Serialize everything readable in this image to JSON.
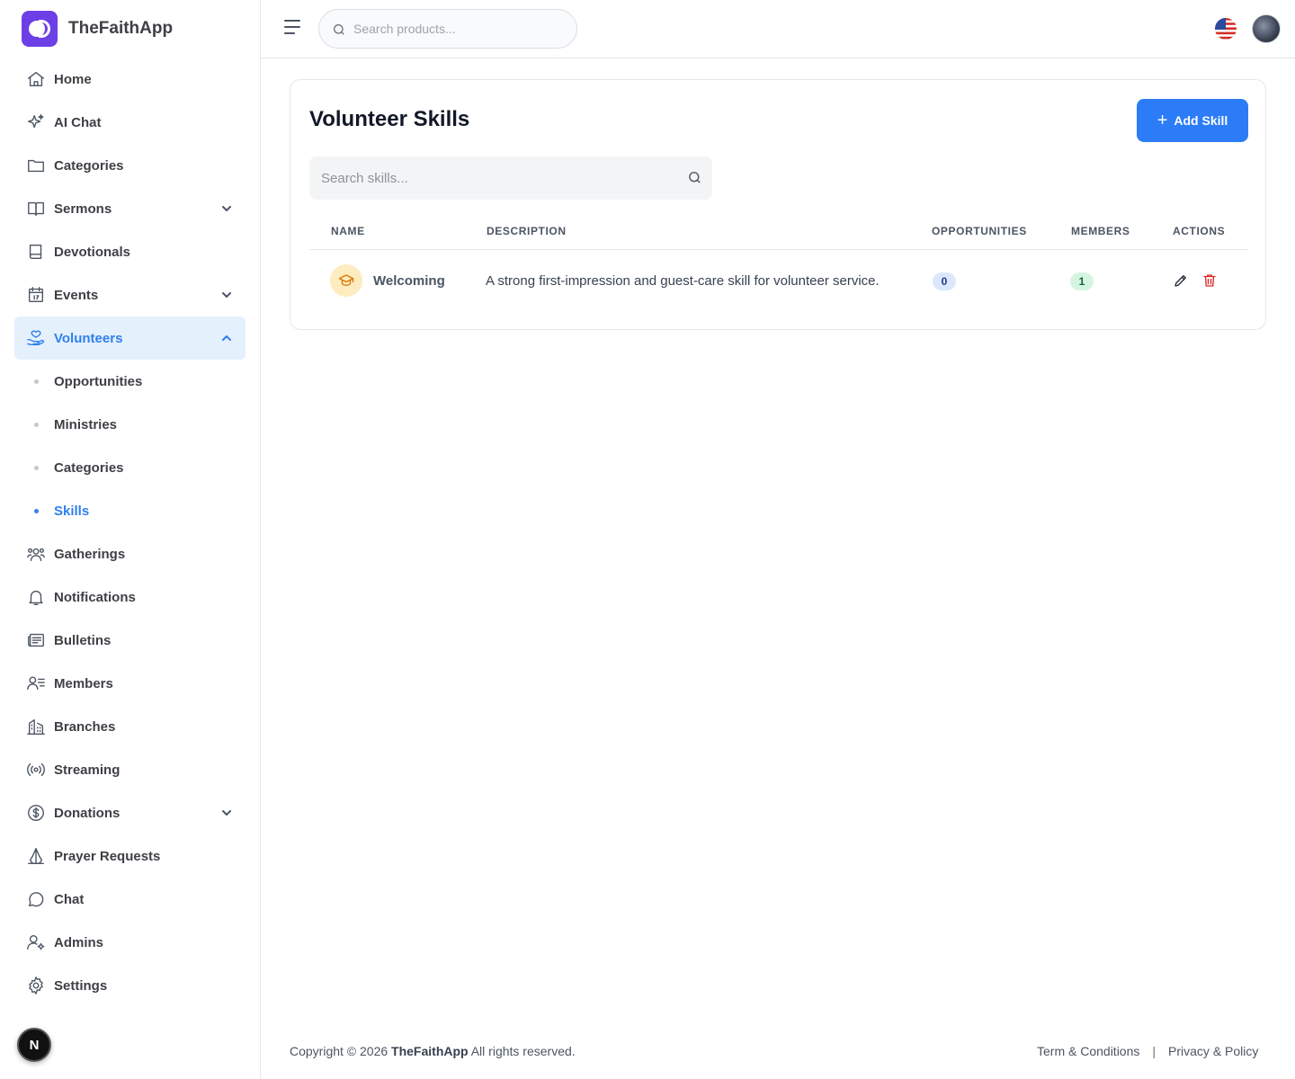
{
  "brand": {
    "name": "TheFaithApp"
  },
  "nav": {
    "home": "Home",
    "ai_chat": "AI Chat",
    "categories": "Categories",
    "sermons": "Sermons",
    "devotionals": "Devotionals",
    "events": "Events",
    "volunteers": "Volunteers",
    "volunteers_sub": {
      "opportunities": "Opportunities",
      "ministries": "Ministries",
      "categories": "Categories",
      "skills": "Skills"
    },
    "gatherings": "Gatherings",
    "notifications": "Notifications",
    "bulletins": "Bulletins",
    "members": "Members",
    "branches": "Branches",
    "streaming": "Streaming",
    "donations": "Donations",
    "prayer_requests": "Prayer Requests",
    "chat": "Chat",
    "admins": "Admins",
    "settings": "Settings",
    "active": "Skills"
  },
  "bottom_badge": "N",
  "header": {
    "search_placeholder": "Search products..."
  },
  "page": {
    "title": "Volunteer Skills",
    "add_button": "Add Skill",
    "search_placeholder": "Search skills...",
    "columns": {
      "name": "NAME",
      "description": "DESCRIPTION",
      "opportunities": "OPPORTUNITIES",
      "members": "MEMBERS",
      "actions": "ACTIONS"
    },
    "rows": [
      {
        "name": "Welcoming",
        "description": "A strong first-impression and guest-care skill for volunteer service.",
        "opportunities": "0",
        "members": "1",
        "icon": "graduation-cap-icon"
      }
    ]
  },
  "footer": {
    "copyright_prefix": "Copyright © 2026",
    "brand": "TheFaithApp",
    "copyright_suffix": "All rights reserved.",
    "terms": "Term & Conditions",
    "privacy": "Privacy & Policy"
  },
  "colors": {
    "accent": "#2b7cf6",
    "brand": "#6d3fe6",
    "active_bg": "#e5f0fd",
    "delete": "#dc2626"
  }
}
